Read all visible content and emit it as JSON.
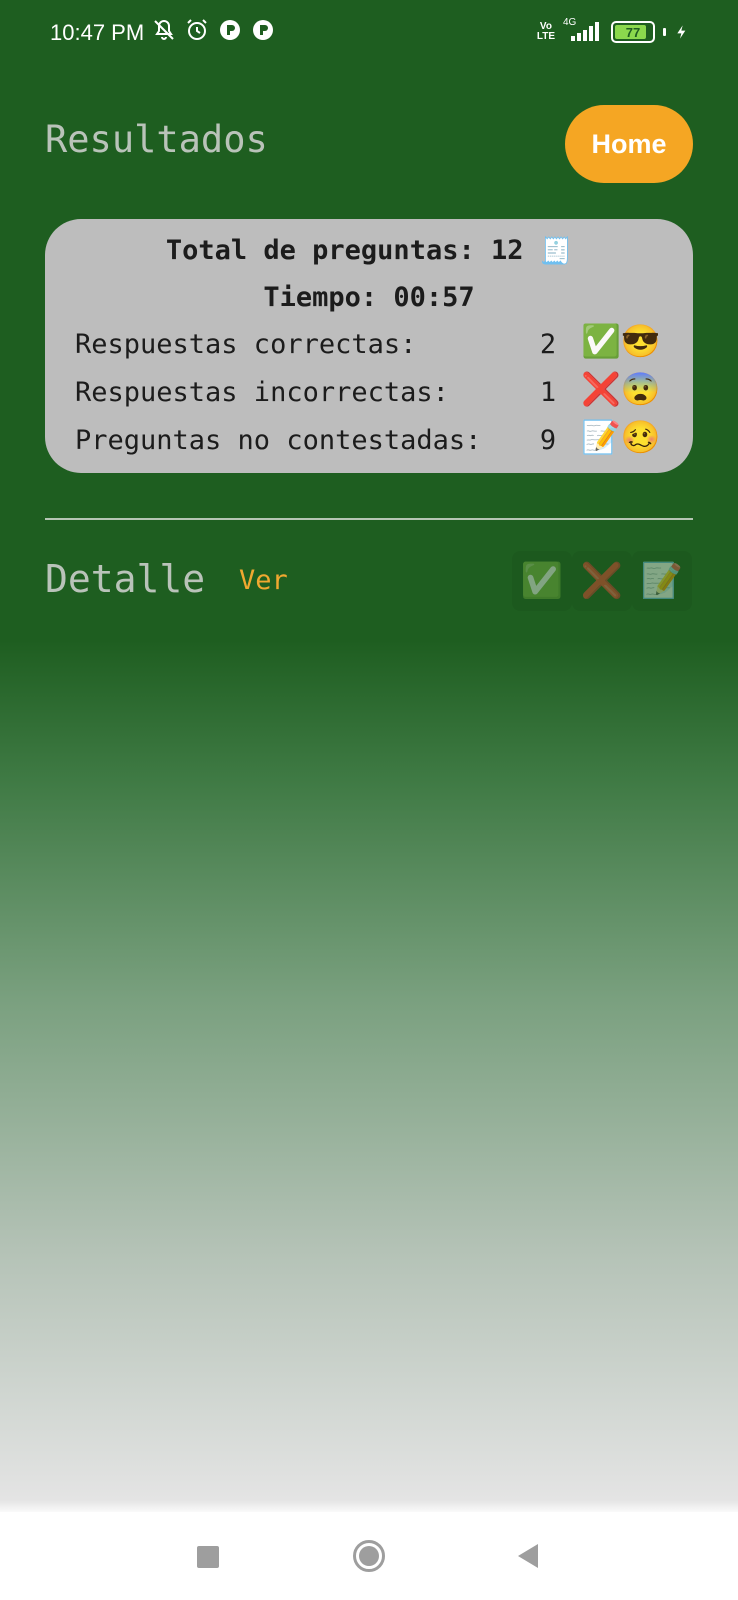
{
  "status_bar": {
    "time": "10:47 PM",
    "network_label_top": "Vo",
    "network_label_bottom": "LTE",
    "network_type": "4G",
    "battery": "77",
    "icons": [
      "mute-icon",
      "alarm-icon",
      "app-notification-icon",
      "app-notification-icon",
      "signal-icon",
      "battery-icon",
      "charging-icon"
    ]
  },
  "header": {
    "title": "Resultados",
    "home_label": "Home"
  },
  "summary": {
    "total_label": "Total de preguntas: 12",
    "total_emoji": "🧾",
    "time_label": "Tiempo: 00:57",
    "rows": [
      {
        "label": "Respuestas correctas:",
        "value": "2",
        "emoji": "✅😎"
      },
      {
        "label": "Respuestas incorrectas:",
        "value": "1",
        "emoji": "❌😨"
      },
      {
        "label": "Preguntas no contestadas:",
        "value": "9",
        "emoji": "📝🥴"
      }
    ]
  },
  "detail": {
    "title": "Detalle",
    "view_label": "Ver",
    "filters": [
      {
        "name": "filter-correct",
        "emoji": "✅"
      },
      {
        "name": "filter-incorrect",
        "emoji": "❌"
      },
      {
        "name": "filter-unanswered",
        "emoji": "📝"
      }
    ]
  },
  "colors": {
    "background_top": "#1e5e20",
    "accent": "#f5a623",
    "card": "#bdbdbd",
    "link": "#f0a830"
  }
}
